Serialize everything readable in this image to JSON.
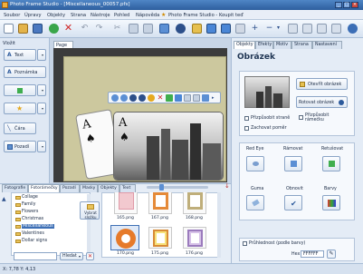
{
  "window": {
    "title": "Photo Frame Studio - [Miscellaneous_00057.pfs]"
  },
  "menu": [
    "Soubor",
    "Úpravy",
    "Objekty",
    "Strana",
    "Nástroje",
    "Pohled",
    "Nápověda",
    "Photo Frame Studio - Koupit teď"
  ],
  "left_panel": {
    "heading": "Vložit",
    "buttons": [
      "Text",
      "Poznámka",
      "",
      "",
      "Čára",
      "Pozadí"
    ]
  },
  "document": {
    "tab": "Page 1"
  },
  "right_panel": {
    "tabs": [
      "Objekty",
      "Efekty",
      "Motiv",
      "Strana",
      "Nastavení"
    ],
    "title": "Obrázek",
    "open_image": "Otevřít obrázek",
    "rotate_image": "Rotovat obrázek",
    "fit_to_page": "Přizpůsobit straně",
    "fit_frame": "Přizpůsobit rámečku",
    "keep_ratio": "Zachovat poměr",
    "effects_row1": [
      "Red Eye",
      "Rámovat",
      "Retušovat"
    ],
    "effects_row2": [
      "Guma",
      "Obnovit",
      "Barvy"
    ],
    "transparency": "Průhlednost (podle barvy)",
    "hex_label": "Hex",
    "hex_value": "FFFFFF"
  },
  "library": {
    "tabs": [
      "Fotografie",
      "Fotorámečky",
      "Pozadí",
      "Masky",
      "Objekty",
      "Text"
    ],
    "tree": [
      "Collage",
      "Family",
      "Flowers",
      "Christmas",
      "Miscellaneous",
      "Valentines",
      "Dollar signs"
    ],
    "selected": "Miscellaneous",
    "side_button": "Vybrat složku",
    "search_button": "Hledat",
    "thumbs_row1": [
      "165.png",
      "167.png",
      "168.png"
    ],
    "thumbs_row2": [
      "170.png",
      "175.png",
      "176.png"
    ]
  },
  "status": {
    "coords": "X: 7,78 Y: 4,13"
  }
}
